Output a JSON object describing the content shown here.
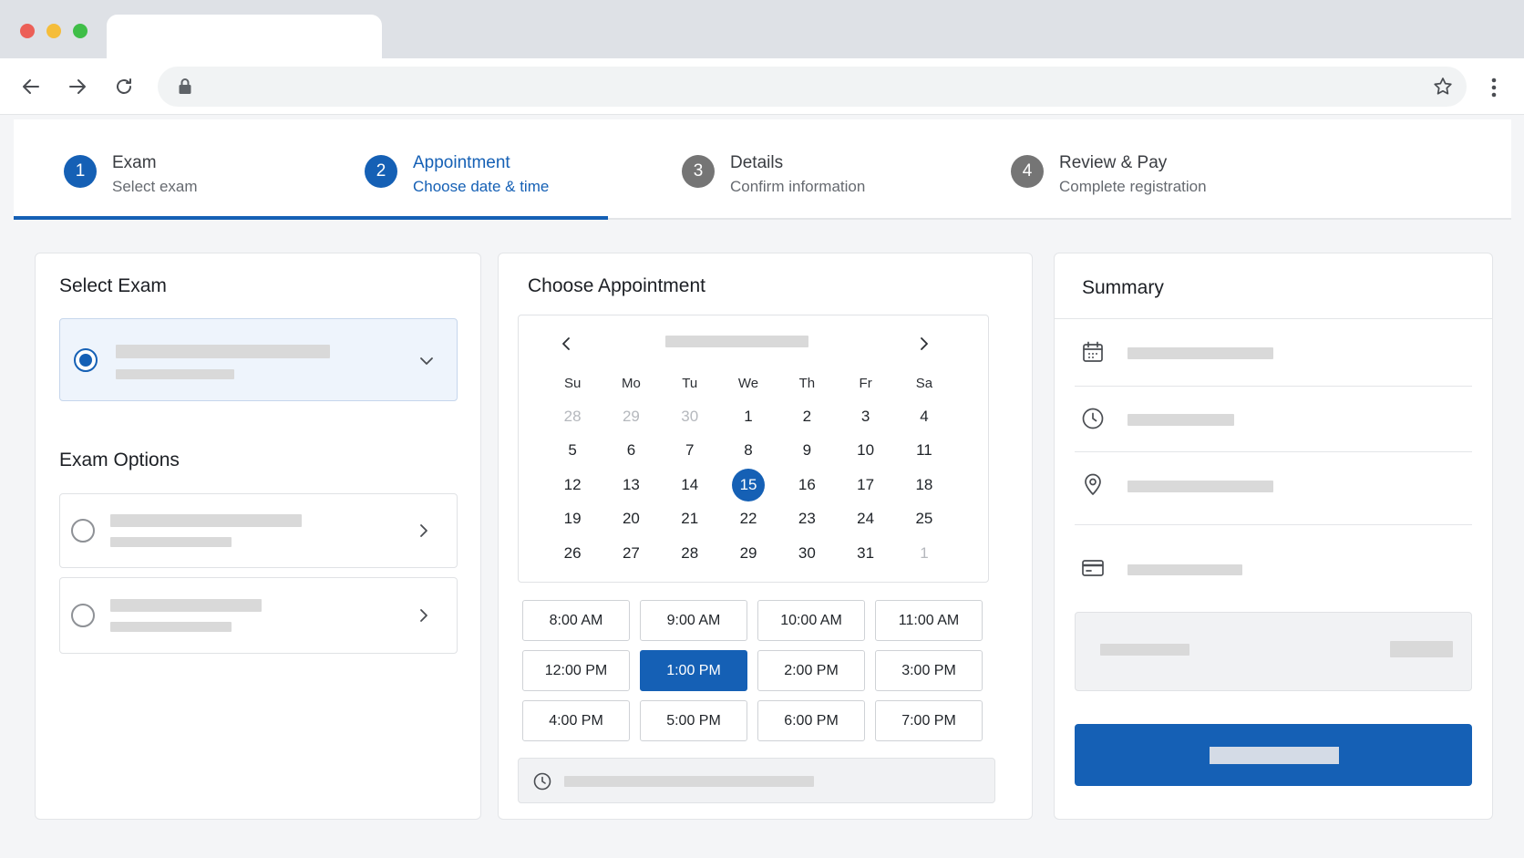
{
  "colors": {
    "accent": "#1560b5",
    "tab_bar": "#dee1e6",
    "page_bg": "#f4f5f7"
  },
  "browser": {
    "icons": [
      "back-arrow-icon",
      "forward-arrow-icon",
      "reload-icon",
      "lock-icon",
      "bookmark-star-icon",
      "more-vert-icon"
    ]
  },
  "stepper": {
    "active_index": 1,
    "steps": [
      {
        "num": "1",
        "title": "Exam",
        "sub": "Select exam"
      },
      {
        "num": "2",
        "title": "Appointment",
        "sub": "Choose date & time"
      },
      {
        "num": "3",
        "title": "Details",
        "sub": "Confirm information"
      },
      {
        "num": "4",
        "title": "Review & Pay",
        "sub": "Complete registration"
      }
    ]
  },
  "select_exam": {
    "title": "Select Exam",
    "options_title": "Exam Options"
  },
  "appointment": {
    "title": "Choose Appointment",
    "weekdays": [
      "Su",
      "Mo",
      "Tu",
      "We",
      "Th",
      "Fr",
      "Sa"
    ],
    "days": [
      [
        "28",
        "29",
        "30",
        "1",
        "2",
        "3",
        "4"
      ],
      [
        "5",
        "6",
        "7",
        "8",
        "9",
        "10",
        "11"
      ],
      [
        "12",
        "13",
        "14",
        "15",
        "16",
        "17",
        "18"
      ],
      [
        "19",
        "20",
        "21",
        "22",
        "23",
        "24",
        "25"
      ],
      [
        "26",
        "27",
        "28",
        "29",
        "30",
        "31",
        "1"
      ]
    ],
    "selected_day": "15",
    "times": [
      "8:00 AM",
      "9:00 AM",
      "10:00 AM",
      "11:00 AM",
      "12:00 PM",
      "1:00 PM",
      "2:00 PM",
      "3:00 PM",
      "4:00 PM",
      "5:00 PM",
      "6:00 PM",
      "7:00 PM"
    ],
    "selected_time": "1:00 PM"
  },
  "summary": {
    "title": "Summary",
    "icons": [
      "calendar-icon",
      "clock-icon",
      "location-pin-icon",
      "credit-card-icon"
    ]
  }
}
